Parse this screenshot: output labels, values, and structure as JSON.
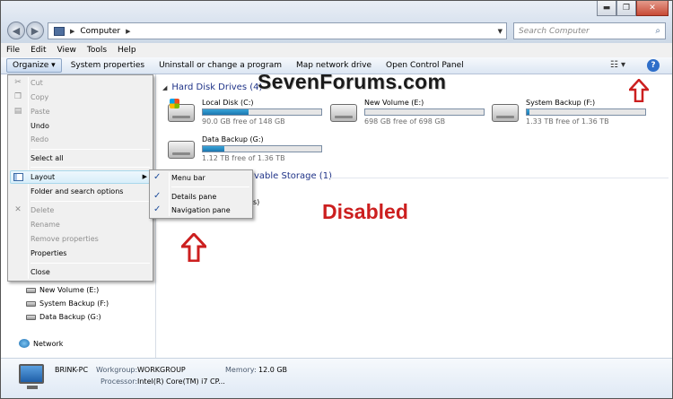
{
  "window": {
    "address": "Computer",
    "search_placeholder": "Search Computer",
    "min_glyph": "▬",
    "max_glyph": "❐",
    "close_glyph": "✕"
  },
  "menubar": [
    "File",
    "Edit",
    "View",
    "Tools",
    "Help"
  ],
  "toolbar": {
    "organize": "Organize ▾",
    "buttons": [
      "System properties",
      "Uninstall or change a program",
      "Map network drive",
      "Open Control Panel"
    ],
    "help": "?"
  },
  "watermark": "SevenForums.com",
  "annotation": "Disabled",
  "groups": {
    "hdd": "Hard Disk Drives (4)",
    "removable_partial": "vable Storage (1)",
    "hidden_fragment": "s)"
  },
  "drives": [
    {
      "name": "Local Disk (C:)",
      "free": "90.0 GB free of 148 GB",
      "used_fraction": 0.39,
      "system": true
    },
    {
      "name": "New Volume (E:)",
      "free": "698 GB free of 698 GB",
      "used_fraction": 0.0,
      "system": false
    },
    {
      "name": "System Backup (F:)",
      "free": "1.33 TB free of 1.36 TB",
      "used_fraction": 0.02,
      "system": false
    },
    {
      "name": "Data Backup (G:)",
      "free": "1.12 TB free of 1.36 TB",
      "used_fraction": 0.18,
      "system": false
    }
  ],
  "organize_menu": {
    "cut": "Cut",
    "copy": "Copy",
    "paste": "Paste",
    "undo": "Undo",
    "redo": "Redo",
    "select_all": "Select all",
    "layout": "Layout",
    "folder_options": "Folder and search options",
    "delete": "Delete",
    "rename": "Rename",
    "remove_properties": "Remove properties",
    "properties": "Properties",
    "close": "Close"
  },
  "layout_submenu": [
    "Menu bar",
    "Details pane",
    "Navigation pane"
  ],
  "navpane": {
    "drives": [
      "New Volume (E:)",
      "System Backup (F:)",
      "Data Backup (G:)"
    ],
    "network": "Network"
  },
  "details": {
    "name": "BRINK-PC",
    "workgroup_label": "Workgroup:",
    "workgroup": "WORKGROUP",
    "memory_label": "Memory:",
    "memory": "12.0 GB",
    "processor_label": "Processor:",
    "processor": "Intel(R) Core(TM) i7 CP..."
  },
  "colors": {
    "annotation_red": "#cc1f1f",
    "header_blue": "#1e3287",
    "drive_fill": "#1b76b0"
  }
}
